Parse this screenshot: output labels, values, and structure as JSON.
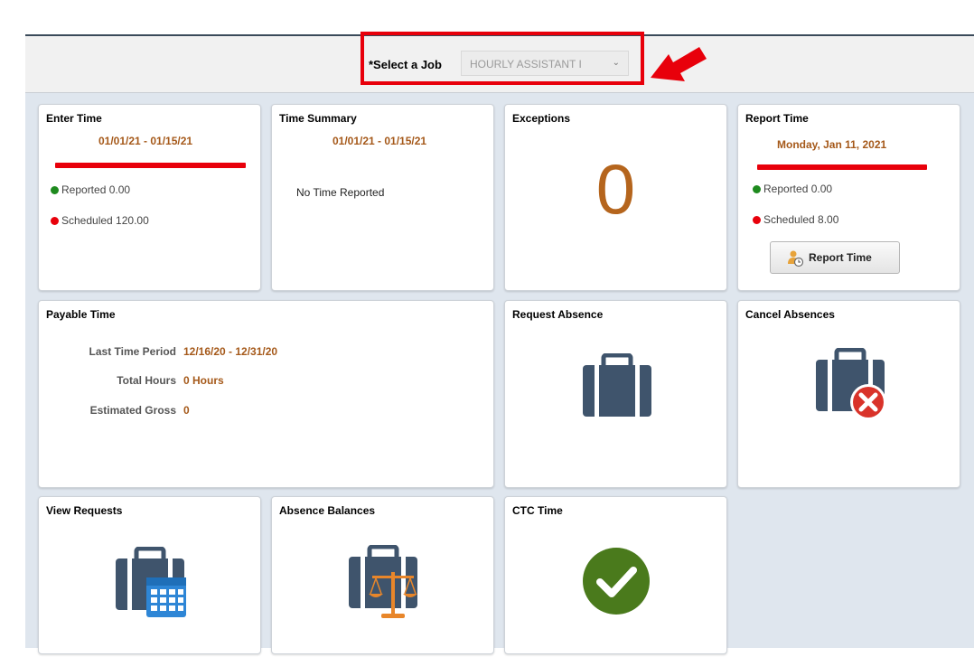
{
  "job": {
    "label": "*Select a Job",
    "value": "HOURLY ASSISTANT I",
    "chevron": "⌄"
  },
  "tiles": {
    "enter_time": {
      "title": "Enter Time",
      "period": "01/01/21 - 01/15/21",
      "reported": "Reported 0.00",
      "scheduled": "Scheduled 120.00"
    },
    "time_summary": {
      "title": "Time Summary",
      "period": "01/01/21 - 01/15/21",
      "message": "No Time Reported"
    },
    "exceptions": {
      "title": "Exceptions",
      "count": "0"
    },
    "report_time": {
      "title": "Report Time",
      "date": "Monday, Jan 11, 2021",
      "reported": "Reported 0.00",
      "scheduled": "Scheduled 8.00",
      "button": "Report Time"
    },
    "payable_time": {
      "title": "Payable Time",
      "last_period_label": "Last Time Period",
      "last_period_value": "12/16/20 - 12/31/20",
      "total_hours_label": "Total Hours",
      "total_hours_value": "0 Hours",
      "estimated_gross_label": "Estimated Gross",
      "estimated_gross_value": "0"
    },
    "request_absence": {
      "title": "Request Absence",
      "icon": "briefcase-icon"
    },
    "cancel_absences": {
      "title": "Cancel Absences",
      "icon": "briefcase-cancel-icon"
    },
    "view_requests": {
      "title": "View Requests",
      "icon": "briefcase-calendar-icon"
    },
    "absence_balances": {
      "title": "Absence Balances",
      "icon": "briefcase-scale-icon"
    },
    "ctc_time": {
      "title": "CTC Time",
      "icon": "checkmark-icon"
    }
  },
  "colors": {
    "accent_text": "#a5591a",
    "highlight_red": "#e8000b",
    "reported_dot": "#1e8a1e",
    "scheduled_dot": "#e8000b",
    "icon_navy": "#3f546c",
    "check_green": "#4a7a1c"
  }
}
